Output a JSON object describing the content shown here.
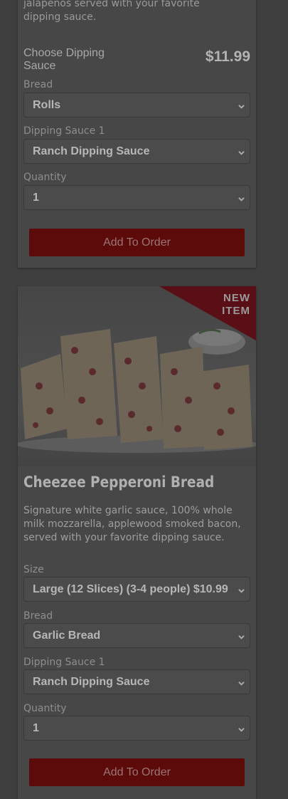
{
  "item1": {
    "description": "jalapeños served with your favorite dipping sauce.",
    "choose_label": "Choose Dipping Sauce",
    "price": "$11.99",
    "bread": {
      "label": "Bread",
      "value": "Rolls"
    },
    "sauce": {
      "label": "Dipping Sauce 1",
      "value": "Ranch Dipping Sauce"
    },
    "quantity": {
      "label": "Quantity",
      "value": "1"
    },
    "add_label": "Add To Order"
  },
  "item2": {
    "badge": "NEW ITEM",
    "image_alt": "Cheezee Pepperoni Bread slices with dipping sauce cup",
    "title": "Cheezee Pepperoni Bread",
    "description": "Signature white garlic sauce, 100% whole milk mozzarella, applewood smoked bacon, served with your favorite dipping sauce.",
    "size": {
      "label": "Size",
      "value": "Large (12 Slices) (3-4 people) $10.99"
    },
    "bread": {
      "label": "Bread",
      "value": "Garlic Bread"
    },
    "sauce": {
      "label": "Dipping Sauce 1",
      "value": "Ranch Dipping Sauce"
    },
    "quantity": {
      "label": "Quantity",
      "value": "1"
    },
    "add_label": "Add To Order"
  },
  "colors": {
    "overlay_bg": "#3f3f3f",
    "card_bg": "#474747",
    "button_bg": "#5c0a0a"
  }
}
